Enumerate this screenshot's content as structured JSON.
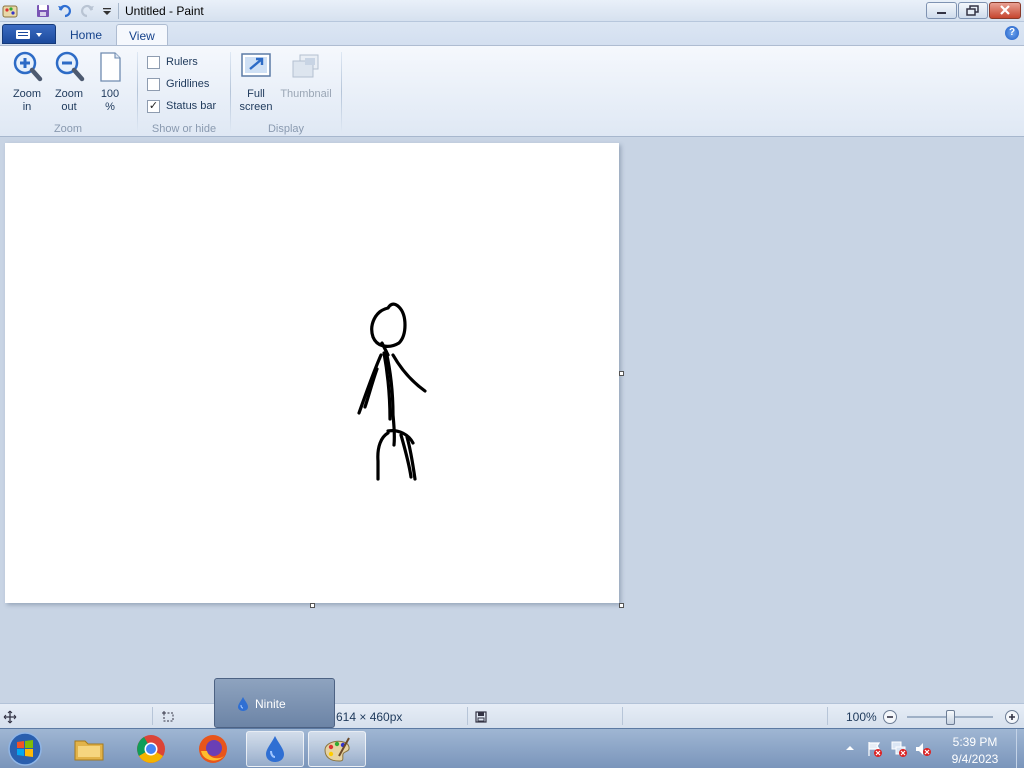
{
  "window": {
    "title": "Untitled - Paint"
  },
  "tabs": [
    {
      "label": "Home",
      "active": false
    },
    {
      "label": "View",
      "active": true
    }
  ],
  "ribbon": {
    "zoom_group": {
      "label": "Zoom",
      "zoom_in": "Zoom\nin",
      "zoom_out": "Zoom\nout",
      "hundred": "100\n%"
    },
    "show_hide_group": {
      "label": "Show or hide",
      "rulers": {
        "label": "Rulers",
        "checked": false
      },
      "gridlines": {
        "label": "Gridlines",
        "checked": false
      },
      "status_bar": {
        "label": "Status bar",
        "checked": true
      }
    },
    "display_group": {
      "label": "Display",
      "full_screen": "Full\nscreen",
      "thumbnail": "Thumbnail"
    }
  },
  "status": {
    "canvas_size": "614 × 460px",
    "zoom": "100%"
  },
  "taskbar": {
    "popup_label": "Ninite",
    "clock_time": "5:39 PM",
    "clock_date": "9/4/2023"
  },
  "colors": {
    "accent": "#1c4a9c",
    "ribbon_bg": "#f5f8fd",
    "workspace_bg": "#c8d4e4"
  }
}
